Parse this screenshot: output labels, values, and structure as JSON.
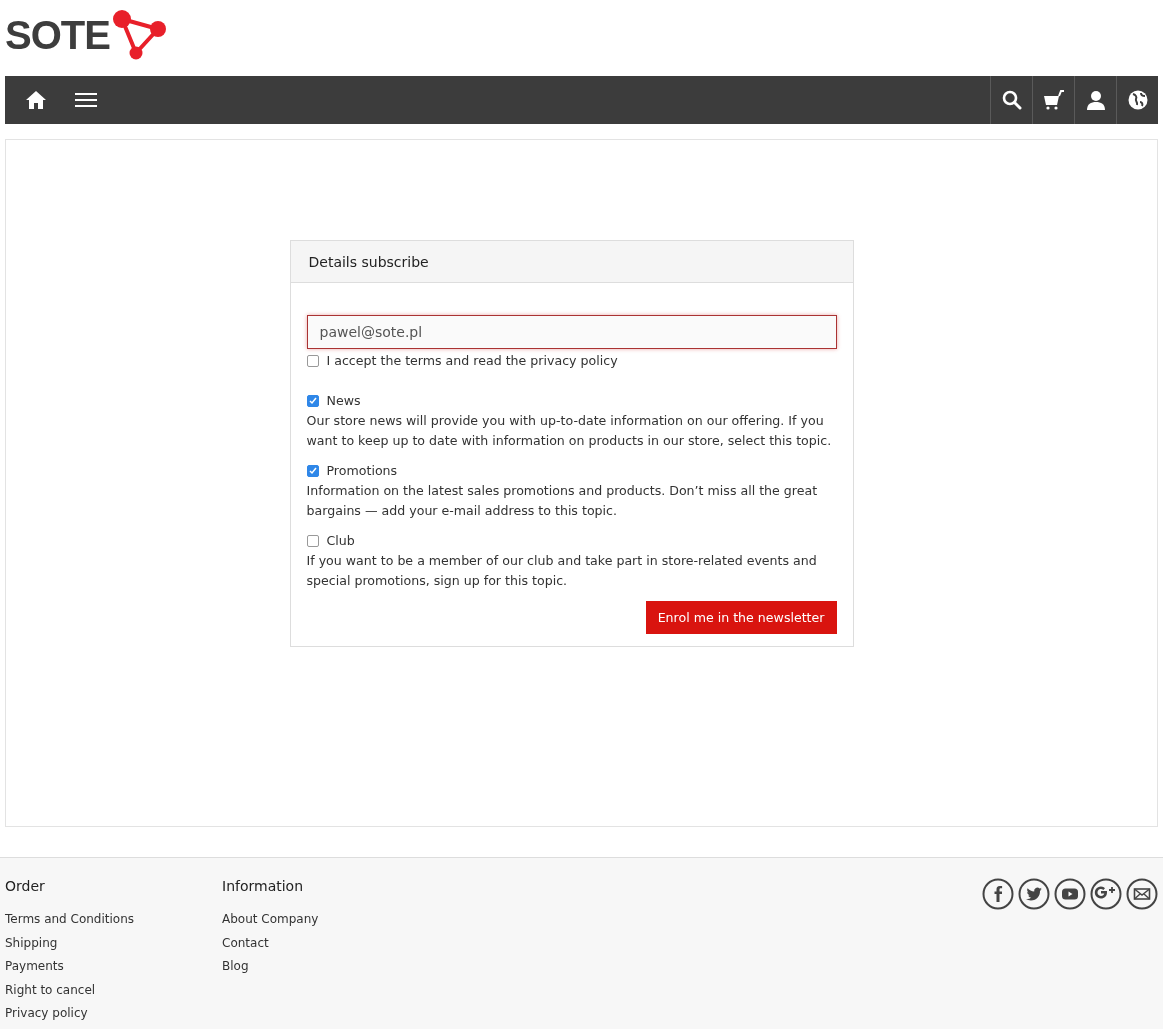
{
  "logo": {
    "text": "SOTE"
  },
  "navbar": {
    "left": [
      {
        "kind": "home"
      },
      {
        "kind": "menu"
      }
    ],
    "right": [
      {
        "kind": "search"
      },
      {
        "kind": "cart"
      },
      {
        "kind": "user"
      },
      {
        "kind": "globe"
      }
    ]
  },
  "panel": {
    "title": "Details subscribe",
    "email": {
      "value": "pawel@sote.pl",
      "invalid": true
    },
    "terms": {
      "label": "I accept the terms and read the privacy policy",
      "checked": false
    },
    "topics": [
      {
        "label": "News",
        "checked": true,
        "description": "Our store news will provide you with up-to-date information on our offering. If you want to keep up to date with information on products in our store, select this topic."
      },
      {
        "label": "Promotions",
        "checked": true,
        "description": "Information on the latest sales promotions and products. Don’t miss all the great bargains — add your e-mail address to this topic."
      },
      {
        "label": "Club",
        "checked": false,
        "description": "If you want to be a member of our club and take part in store-related events and special promotions, sign up for this topic."
      }
    ],
    "button": "Enrol me in the newsletter"
  },
  "footer": {
    "columns": [
      {
        "title": "Order",
        "links": [
          "Terms and Conditions",
          "Shipping",
          "Payments",
          "Right to cancel",
          "Privacy policy"
        ]
      },
      {
        "title": "Information",
        "links": [
          "About Company",
          "Contact",
          "Blog"
        ]
      }
    ],
    "social": [
      {
        "kind": "facebook"
      },
      {
        "kind": "twitter"
      },
      {
        "kind": "youtube"
      },
      {
        "kind": "gplus"
      },
      {
        "kind": "email"
      }
    ]
  }
}
